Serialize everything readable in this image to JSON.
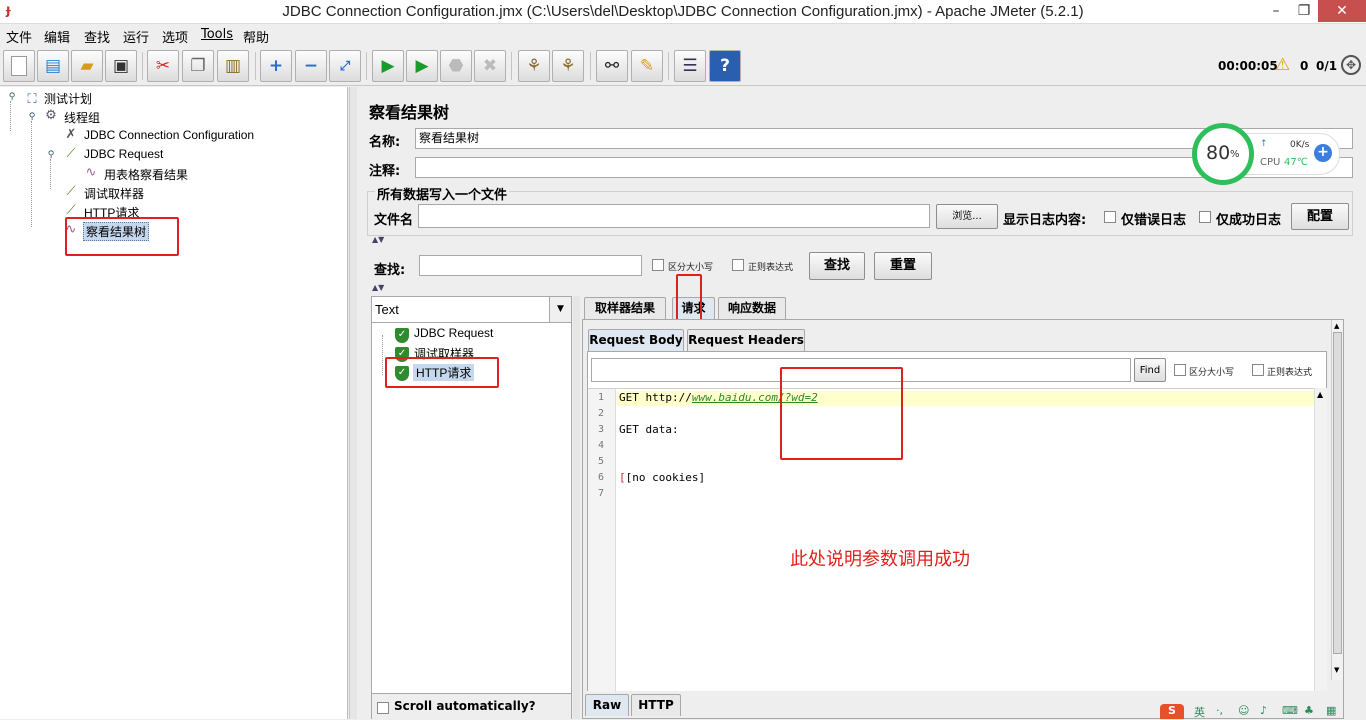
{
  "window": {
    "title": "JDBC Connection Configuration.jmx (C:\\Users\\del\\Desktop\\JDBC Connection Configuration.jmx) - Apache JMeter (5.2.1)",
    "minimize": "–",
    "maximize": "❐",
    "close": "✕"
  },
  "menu": [
    "文件",
    "编辑",
    "查找",
    "运行",
    "选项",
    "Tools",
    "帮助"
  ],
  "toolbar": {
    "icons": [
      "new-icon",
      "templates-icon",
      "open-icon",
      "save-icon",
      "cut-icon",
      "copy-icon",
      "paste-icon",
      "expand-icon",
      "collapse-icon",
      "toggle-icon",
      "start-icon",
      "start-no-pause-icon",
      "stop-icon",
      "shutdown-icon",
      "clear-icon",
      "clear-all-icon",
      "search-icon",
      "reset-search-icon",
      "function-helper-icon",
      "help-icon"
    ],
    "timer": "00:00:05",
    "warnings": "0",
    "threads": "0/1"
  },
  "tree": {
    "items": [
      {
        "label": "测试计划",
        "icon": "test-plan-icon"
      },
      {
        "label": "线程组",
        "icon": "thread-group-icon"
      },
      {
        "label": "JDBC Connection Configuration",
        "icon": "config-wrench-icon"
      },
      {
        "label": "JDBC Request",
        "icon": "sampler-pipette-icon"
      },
      {
        "label": "用表格察看结果",
        "icon": "listener-chart-icon"
      },
      {
        "label": "调试取样器",
        "icon": "sampler-pipette-icon"
      },
      {
        "label": "HTTP请求",
        "icon": "sampler-pipette-icon"
      },
      {
        "label": "察看结果树",
        "icon": "listener-chart-icon",
        "selected": true
      }
    ]
  },
  "panel": {
    "title": "察看结果树",
    "name_label": "名称:",
    "name_value": "察看结果树",
    "comment_label": "注释:",
    "comment_value": "",
    "file_group_title": "所有数据写入一个文件",
    "file_label": "文件名",
    "file_value": "",
    "browse_button": "浏览...",
    "log_content_label": "显示日志内容:",
    "errors_only_label": "仅错误日志",
    "success_only_label": "仅成功日志",
    "configure_button": "配置",
    "search_label": "查找:",
    "search_value": "",
    "case_sensitive_label": "区分大小写",
    "regex_label": "正则表达式",
    "search_button": "查找",
    "reset_button": "重置"
  },
  "results": {
    "renderer": "Text",
    "samples": [
      "JDBC Request",
      "调试取样器",
      "HTTP请求"
    ],
    "scroll_auto_label": "Scroll automatically?"
  },
  "detail": {
    "tabs": [
      "取样器结果",
      "请求",
      "响应数据"
    ],
    "subtabs": [
      "Request Body",
      "Request Headers"
    ],
    "find_button": "Find",
    "find_case_label": "区分大小写",
    "find_regex_label": "正则表达式",
    "code_lines": [
      "GET http://",
      "",
      "GET data:",
      "",
      "",
      "[no cookies]",
      ""
    ],
    "url_link": "www.baidu.com/?wd=2",
    "line_numbers": [
      "1",
      "2",
      "3",
      "4",
      "5",
      "6",
      "7"
    ],
    "bottom_tabs": [
      "Raw",
      "HTTP"
    ],
    "annotation": "此处说明参数调用成功"
  },
  "widget": {
    "percent": "80",
    "percent_unit": "%",
    "speed": "0K/s",
    "cpu_label": "CPU",
    "cpu_temp": "47℃"
  },
  "colors": {
    "annotation_red": "#e0201c",
    "highlight_line": "#ffffcc",
    "link_green": "#2a8a2a",
    "widget_green": "#2fbf5a"
  }
}
